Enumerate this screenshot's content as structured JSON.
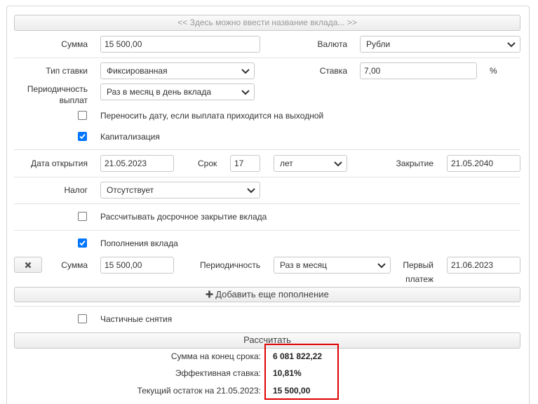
{
  "header": {
    "title_placeholder": "<< Здесь можно ввести название вклада... >>"
  },
  "sum": {
    "label": "Сумма",
    "value": "15 500,00"
  },
  "currency": {
    "label": "Валюта",
    "value": "Рубли"
  },
  "rate_type": {
    "label": "Тип ставки",
    "value": "Фиксированная"
  },
  "rate": {
    "label": "Ставка",
    "value": "7,00",
    "unit": "%"
  },
  "payout": {
    "label_line1": "Периодичность",
    "label_line2": "выплат",
    "value": "Раз в месяц в день вклада"
  },
  "options": {
    "move_date": {
      "label": "Переносить дату, если выплата приходится на выходной",
      "checked": false
    },
    "capitalization": {
      "label": "Капитализация",
      "checked": true
    }
  },
  "dates": {
    "open_label": "Дата открытия",
    "open_value": "21.05.2023",
    "term_label": "Срок",
    "term_value": "17",
    "term_unit": "лет",
    "close_label": "Закрытие",
    "close_value": "21.05.2040"
  },
  "tax": {
    "label": "Налог",
    "value": "Отсутствует"
  },
  "early_close": {
    "label": "Рассчитывать досрочное закрытие вклада",
    "checked": false
  },
  "deposits": {
    "label": "Пополнения вклада",
    "checked": true,
    "remove_icon": "close-icon",
    "sum_label": "Сумма",
    "sum_value": "15 500,00",
    "period_label": "Периодичность",
    "period_value": "Раз в месяц",
    "first_label_line1": "Первый",
    "first_label_line2": "платеж",
    "first_value": "21.06.2023",
    "add_label": "Добавить еще пополнение"
  },
  "withdrawals": {
    "label": "Частичные снятия",
    "checked": false
  },
  "calculate_label": "Рассчитать",
  "results": {
    "end_sum_label": "Сумма на конец срока:",
    "end_sum_value": "6 081 822,22",
    "eff_rate_label": "Эффективная ставка:",
    "eff_rate_value": "10,81%",
    "balance_label": "Текущий остаток на 21.05.2023:",
    "balance_value": "15 500,00"
  },
  "colors": {
    "checkbox": "#0075ff",
    "highlight": "#e00000"
  }
}
